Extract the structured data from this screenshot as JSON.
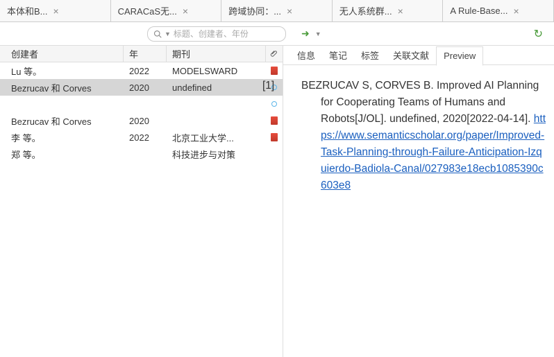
{
  "tabs": [
    {
      "label": "本体和B..."
    },
    {
      "label": "CARACaS无..."
    },
    {
      "label": "跨域协同：..."
    },
    {
      "label": "无人系统群..."
    },
    {
      "label": "A Rule-Base..."
    }
  ],
  "search": {
    "placeholder": "标题、创建者、年份"
  },
  "columns": {
    "creator": "创建者",
    "year": "年",
    "journal": "期刊",
    "attach": "📎"
  },
  "rows": [
    {
      "creator": "Lu 等。",
      "year": "2022",
      "journal": "MODELSWARD",
      "attach": "pdf",
      "selected": false
    },
    {
      "creator": "Bezrucav 和 Corves",
      "year": "2020",
      "journal": "undefined",
      "attach": "dot",
      "selected": true
    },
    {
      "creator": "",
      "year": "",
      "journal": "",
      "attach": "dot",
      "selected": false
    },
    {
      "creator": "Bezrucav 和 Corves",
      "year": "2020",
      "journal": "",
      "attach": "pdf",
      "selected": false
    },
    {
      "creator": "李 等。",
      "year": "2022",
      "journal": "北京工业大学...",
      "attach": "pdf",
      "selected": false
    },
    {
      "creator": "郑 等。",
      "year": "",
      "journal": "科技进步与对策",
      "attach": "",
      "selected": false
    }
  ],
  "detail_tabs": [
    {
      "label": "信息",
      "active": false
    },
    {
      "label": "笔记",
      "active": false
    },
    {
      "label": "标签",
      "active": false
    },
    {
      "label": "关联文献",
      "active": false
    },
    {
      "label": "Preview",
      "active": true
    }
  ],
  "citation": {
    "num": "[1]",
    "text": "BEZRUCAV S, CORVES B. Improved AI Planning for Cooperating Teams of Humans and Robots[J/OL]. undefined, 2020[2022-04-14]. ",
    "link": "https://www.semanticscholar.org/paper/Improved-Task-Planning-through-Failure-Anticipation-Izquierdo-Badiola-Canal/027983e18ecb1085390c603e8"
  }
}
